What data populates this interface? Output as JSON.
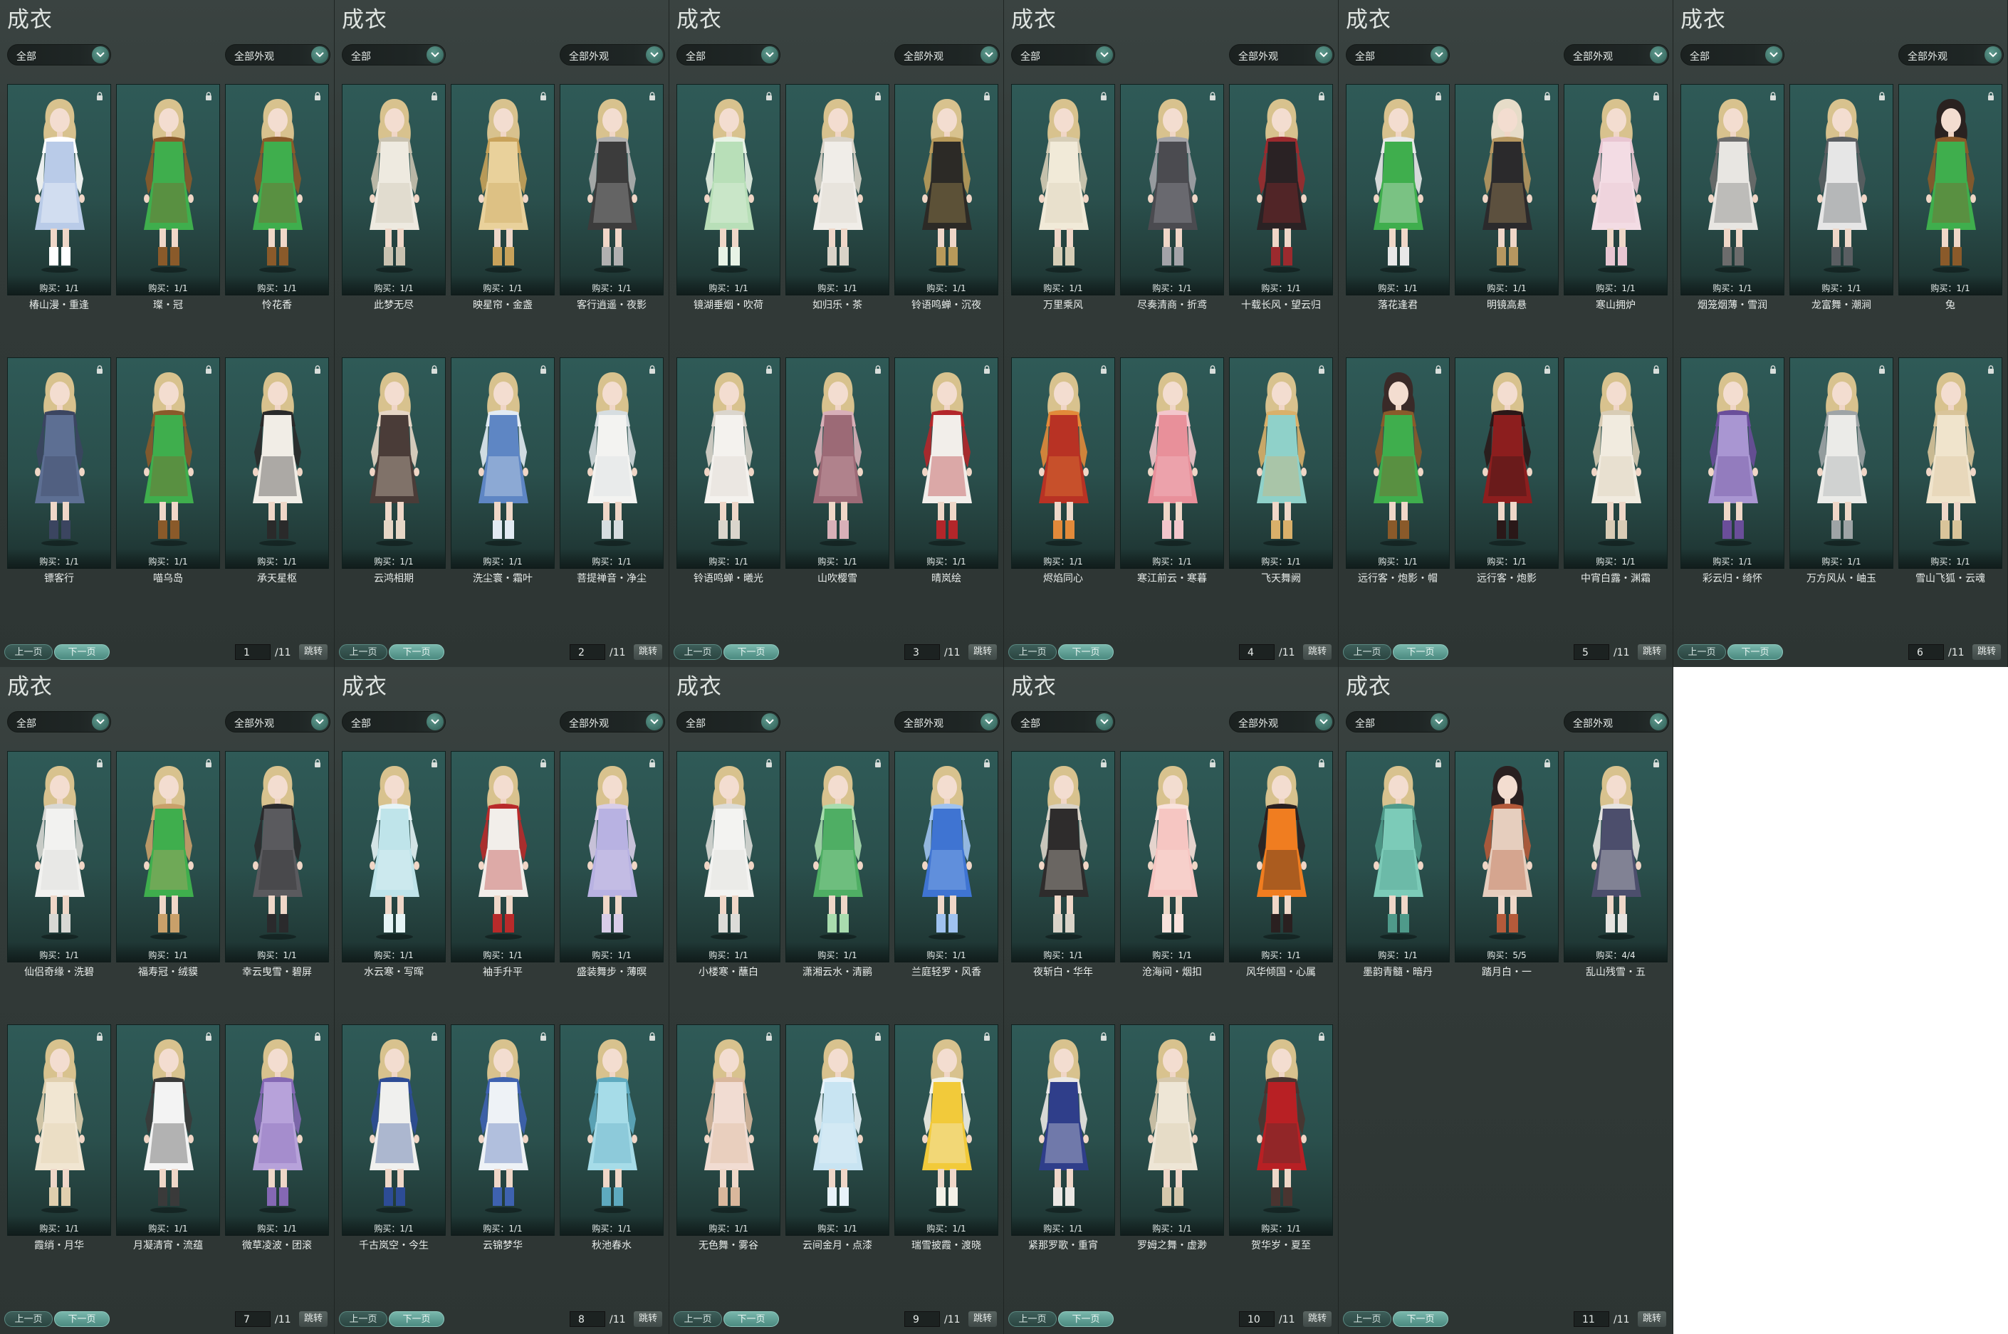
{
  "panel_title": "成衣",
  "filter_left": "全部",
  "filter_right": "全部外观",
  "prev_label": "上一页",
  "next_label": "下一页",
  "jump_label": "跳转",
  "total_label": "/11",
  "icons": {
    "lock": "lock-icon",
    "dropdown": "chevron-down-icon"
  },
  "colors": {
    "panel_bg": "#343c3a",
    "card_bg": "#2b504d",
    "accent": "#5e9a8e"
  },
  "pages": [
    {
      "page": "1",
      "items": [
        {
          "name": "椿山漫・重逢",
          "buy": "购买：1/1",
          "c1": "#b9cbe8",
          "c2": "#ffffff",
          "hair": "#d8c28e"
        },
        {
          "name": "璨・冠",
          "buy": "购买：1/1",
          "c1": "#3fae4d",
          "c2": "#8a5a2a",
          "hair": "#d8c28e"
        },
        {
          "name": "怜花香",
          "buy": "购买：1/1",
          "c1": "#3fae4d",
          "c2": "#8a5a2a",
          "hair": "#d8c28e"
        },
        {
          "name": "镖客行",
          "buy": "购买：1/1",
          "c1": "#5d6f93",
          "c2": "#3b4560",
          "hair": "#d8c28e"
        },
        {
          "name": "喵乌岛",
          "buy": "购买：1/1",
          "c1": "#3fae4d",
          "c2": "#8a5a2a",
          "hair": "#d8c28e"
        },
        {
          "name": "承天星枢",
          "buy": "购买：1/1",
          "c1": "#f1ede6",
          "c2": "#2a2a2a",
          "hair": "#d8c28e"
        }
      ]
    },
    {
      "page": "2",
      "items": [
        {
          "name": "此梦无尽",
          "buy": "购买：1/1",
          "c1": "#eeeae0",
          "c2": "#c9c2b0",
          "hair": "#d8c28e"
        },
        {
          "name": "映星帘・金盏",
          "buy": "购买：1/1",
          "c1": "#e9d19b",
          "c2": "#c8a25a",
          "hair": "#d8c28e"
        },
        {
          "name": "客行逍遥・夜影",
          "buy": "购买：1/1",
          "c1": "#3c3c3c",
          "c2": "#b0b0b0",
          "hair": "#d8c28e"
        },
        {
          "name": "云鸿相期",
          "buy": "购买：1/1",
          "c1": "#4a3c38",
          "c2": "#e6d7c6",
          "hair": "#d8c28e"
        },
        {
          "name": "洗尘寰・霜叶",
          "buy": "购买：1/1",
          "c1": "#5e86c4",
          "c2": "#e2ebf3",
          "hair": "#d8c28e"
        },
        {
          "name": "菩提禅音・净尘",
          "buy": "购买：1/1",
          "c1": "#f3f3f1",
          "c2": "#d6dde0",
          "hair": "#d8c28e"
        }
      ]
    },
    {
      "page": "3",
      "items": [
        {
          "name": "镜湖垂烟・吹荷",
          "buy": "购买：1/1",
          "c1": "#b8dfb8",
          "c2": "#e8f3e6",
          "hair": "#d8c28e"
        },
        {
          "name": "如归乐・茶",
          "buy": "购买：1/1",
          "c1": "#f0ede8",
          "c2": "#d9d3c8",
          "hair": "#d8c28e"
        },
        {
          "name": "铃语鸣蝉・沉夜",
          "buy": "购买：1/1",
          "c1": "#2c2a26",
          "c2": "#b89a5a",
          "hair": "#d8c28e"
        },
        {
          "name": "铃语鸣蝉・曦光",
          "buy": "购买：1/1",
          "c1": "#f4f2ee",
          "c2": "#dad5cc",
          "hair": "#d8c28e"
        },
        {
          "name": "山吹樱雪",
          "buy": "购买：1/1",
          "c1": "#9c6a76",
          "c2": "#d8b0b8",
          "hair": "#d8c28e"
        },
        {
          "name": "晴岚绘",
          "buy": "购买：1/1",
          "c1": "#f2eeea",
          "c2": "#b3262a",
          "hair": "#d8c28e"
        }
      ]
    },
    {
      "page": "4",
      "items": [
        {
          "name": "万里乘风",
          "buy": "购买：1/1",
          "c1": "#f1ead8",
          "c2": "#d6cdb6",
          "hair": "#d8c28e"
        },
        {
          "name": "尽奏清商・折鸢",
          "buy": "购买：1/1",
          "c1": "#4b4b50",
          "c2": "#a3a3a8",
          "hair": "#d8c28e"
        },
        {
          "name": "十载长风・望云归",
          "buy": "购买：1/1",
          "c1": "#2a2224",
          "c2": "#9b2a2e",
          "hair": "#d8c28e"
        },
        {
          "name": "烬焰同心",
          "buy": "购买：1/1",
          "c1": "#b83224",
          "c2": "#e28a3a",
          "hair": "#d8c28e"
        },
        {
          "name": "寒江前云・寒暮",
          "buy": "购买：1/1",
          "c1": "#e8909a",
          "c2": "#f3c6cc",
          "hair": "#d8c28e"
        },
        {
          "name": "飞天舞阙",
          "buy": "购买：1/1",
          "c1": "#8fd1c9",
          "c2": "#d9b06a",
          "hair": "#d8c28e"
        }
      ]
    },
    {
      "page": "5",
      "items": [
        {
          "name": "落花逢君",
          "buy": "购买：1/1",
          "c1": "#3fae4d",
          "c2": "#e8e8e8",
          "hair": "#d8c28e"
        },
        {
          "name": "明镜高悬",
          "buy": "购买：1/1",
          "c1": "#2b2a2c",
          "c2": "#b69760",
          "hair": "#e6dcc8"
        },
        {
          "name": "寒山拥炉",
          "buy": "购买：1/1",
          "c1": "#f3dce4",
          "c2": "#e8c6d2",
          "hair": "#d8c28e"
        },
        {
          "name": "远行客・炮影・帽",
          "buy": "购买：1/1",
          "c1": "#3fae4d",
          "c2": "#8a5a2a",
          "hair": "#3a2a28"
        },
        {
          "name": "远行客・炮影",
          "buy": "购买：1/1",
          "c1": "#8c1e1e",
          "c2": "#2a1818",
          "hair": "#d8c28e"
        },
        {
          "name": "中宵白露・渊霜",
          "buy": "购买：1/1",
          "c1": "#f1ebdf",
          "c2": "#d8ccb5",
          "hair": "#d8c28e"
        }
      ]
    },
    {
      "page": "6",
      "items": [
        {
          "name": "烟笼烟薄・雪润",
          "buy": "购买：1/1",
          "c1": "#e8e6e2",
          "c2": "#6c6c6c",
          "hair": "#d8c28e"
        },
        {
          "name": "龙富舞・潮涧",
          "buy": "购买：1/1",
          "c1": "#e6e6e6",
          "c2": "#5a5e62",
          "hair": "#d8c28e"
        },
        {
          "name": "兔",
          "buy": "购买：1/1",
          "c1": "#3fae4d",
          "c2": "#8a5a2a",
          "hair": "#2a2220"
        },
        {
          "name": "彩云归・绮怀",
          "buy": "购买：1/1",
          "c1": "#a996d2",
          "c2": "#6a4e9a",
          "hair": "#d8c28e"
        },
        {
          "name": "万方风从・岫玉",
          "buy": "购买：1/1",
          "c1": "#ebebe8",
          "c2": "#9ea4a6",
          "hair": "#d8c28e"
        },
        {
          "name": "雪山飞狐・云魂",
          "buy": "购买：1/1",
          "c1": "#f0e4cc",
          "c2": "#d9c49a",
          "hair": "#d8c28e"
        }
      ]
    },
    {
      "page": "7",
      "items": [
        {
          "name": "仙侣奇缘・洗碧",
          "buy": "购买：1/1",
          "c1": "#f2f2f0",
          "c2": "#d8d8d4",
          "hair": "#d8c28e"
        },
        {
          "name": "福寿冠・绒貘",
          "buy": "购买：1/1",
          "c1": "#3fae4d",
          "c2": "#c9a06a",
          "hair": "#d8c28e"
        },
        {
          "name": "幸云曳雪・碧屏",
          "buy": "购买：1/1",
          "c1": "#5a5a5e",
          "c2": "#2a2a2c",
          "hair": "#d8c28e"
        },
        {
          "name": "霞绡・月华",
          "buy": "购买：1/1",
          "c1": "#f1e6d2",
          "c2": "#e0cfae",
          "hair": "#d8c28e"
        },
        {
          "name": "月凝清宵・流蕴",
          "buy": "购买：1/1",
          "c1": "#f3f3f3",
          "c2": "#3a3a3a",
          "hair": "#d8c28e"
        },
        {
          "name": "微草凌波・团滚",
          "buy": "购买：1/1",
          "c1": "#b7a2da",
          "c2": "#8468b4",
          "hair": "#d8c28e"
        }
      ]
    },
    {
      "page": "8",
      "items": [
        {
          "name": "水云寒・写晖",
          "buy": "购买：1/1",
          "c1": "#bfe4ea",
          "c2": "#e6f4f6",
          "hair": "#d8c28e"
        },
        {
          "name": "袖手升平",
          "buy": "购买：1/1",
          "c1": "#f2eeea",
          "c2": "#b82a2a",
          "hair": "#d8c28e"
        },
        {
          "name": "盛装舞步・薄暝",
          "buy": "购买：1/1",
          "c1": "#b8b2e2",
          "c2": "#d8cde8",
          "hair": "#d8c28e"
        },
        {
          "name": "千古岚空・今生",
          "buy": "购买：1/1",
          "c1": "#f0f0ee",
          "c2": "#2d4c96",
          "hair": "#d8c28e"
        },
        {
          "name": "云锦梦华",
          "buy": "购买：1/1",
          "c1": "#eef2f6",
          "c2": "#3e62b0",
          "hair": "#d8c28e"
        },
        {
          "name": "秋池春水",
          "buy": "购买：1/1",
          "c1": "#a6dce8",
          "c2": "#5eaabf",
          "hair": "#d8c28e"
        }
      ]
    },
    {
      "page": "9",
      "items": [
        {
          "name": "小楼寒・蘸白",
          "buy": "购买：1/1",
          "c1": "#f3f3f1",
          "c2": "#dcdcd8",
          "hair": "#d8c28e"
        },
        {
          "name": "潇湘云水・清鹂",
          "buy": "购买：1/1",
          "c1": "#4fae64",
          "c2": "#a9dcae",
          "hair": "#d8c28e"
        },
        {
          "name": "兰庭轻罗・风香",
          "buy": "购买：1/1",
          "c1": "#3f74d2",
          "c2": "#9fc2f0",
          "hair": "#d8c28e"
        },
        {
          "name": "无色舞・雾谷",
          "buy": "购买：1/1",
          "c1": "#f1dcd2",
          "c2": "#d9b79c",
          "hair": "#d8c28e"
        },
        {
          "name": "云间金月・点漆",
          "buy": "购买：1/1",
          "c1": "#c8e4f2",
          "c2": "#e8f3fa",
          "hair": "#d8c28e"
        },
        {
          "name": "瑞雪披霞・渡晓",
          "buy": "购买：1/1",
          "c1": "#f2ca3a",
          "c2": "#f3f1e8",
          "hair": "#d8c28e"
        }
      ]
    },
    {
      "page": "10",
      "items": [
        {
          "name": "夜斩白・华年",
          "buy": "购买：1/1",
          "c1": "#2e2c2c",
          "c2": "#d9d3c8",
          "hair": "#d8c28e"
        },
        {
          "name": "沧海间・烟扣",
          "buy": "购买：1/1",
          "c1": "#f6c6c2",
          "c2": "#f9e2dc",
          "hair": "#d8c28e"
        },
        {
          "name": "风华倾国・心属",
          "buy": "购买：1/1",
          "c1": "#f07d20",
          "c2": "#2a2020",
          "hair": "#d8c28e"
        },
        {
          "name": "紧那罗歌・重宵",
          "buy": "购买：1/1",
          "c1": "#2f3e8a",
          "c2": "#ebe8e4",
          "hair": "#d8c28e"
        },
        {
          "name": "罗姆之舞・虚渺",
          "buy": "购买：1/1",
          "c1": "#eee6d6",
          "c2": "#d6c8ac",
          "hair": "#d8c28e"
        },
        {
          "name": "贺华岁・夏至",
          "buy": "购买：1/1",
          "c1": "#b82024",
          "c2": "#4a3430",
          "hair": "#d8c28e"
        }
      ]
    },
    {
      "page": "11",
      "items": [
        {
          "name": "墨韵青髓・暗丹",
          "buy": "购买：1/1",
          "c1": "#7ccbb8",
          "c2": "#4f9a8a",
          "hair": "#d8c28e"
        },
        {
          "name": "踏月白・一",
          "buy": "购买：5/5",
          "c1": "#e6cebe",
          "c2": "#b55a3a",
          "hair": "#2a2020"
        },
        {
          "name": "乱山残雪・五",
          "buy": "购买：4/4",
          "c1": "#4c4e6c",
          "c2": "#e6e4e0",
          "hair": "#d8c28e"
        }
      ]
    }
  ]
}
